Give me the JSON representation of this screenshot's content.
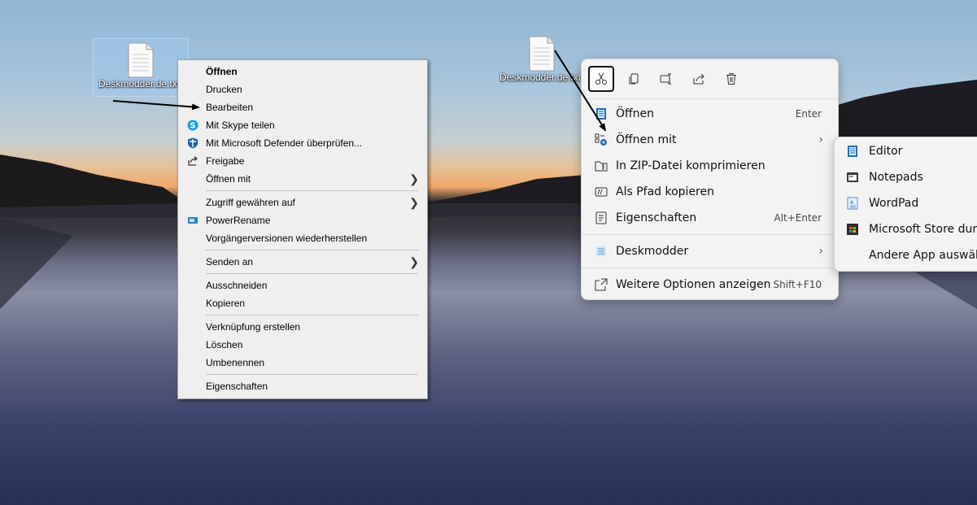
{
  "desktop": {
    "icons": [
      {
        "label": "Deskmodder.de.txt"
      },
      {
        "label": "Deskmodder.de.txt"
      }
    ]
  },
  "classic_menu": {
    "items": [
      {
        "label": "Öffnen",
        "icon": "none"
      },
      {
        "label": "Drucken",
        "icon": "none"
      },
      {
        "label": "Bearbeiten",
        "icon": "none"
      },
      {
        "label": "Mit Skype teilen",
        "icon": "skype-icon"
      },
      {
        "label": "Mit Microsoft Defender überprüfen...",
        "icon": "defender-icon"
      },
      {
        "label": "Freigabe",
        "icon": "share-icon"
      },
      {
        "label": "Öffnen mit",
        "icon": "none"
      },
      {
        "label": "Zugriff gewähren auf",
        "icon": "none"
      },
      {
        "label": "PowerRename",
        "icon": "powerrename-icon"
      },
      {
        "label": "Vorgängerversionen wiederherstellen",
        "icon": "none"
      },
      {
        "label": "Senden an",
        "icon": "none"
      },
      {
        "label": "Ausschneiden",
        "icon": "none"
      },
      {
        "label": "Kopieren",
        "icon": "none"
      },
      {
        "label": "Verknüpfung erstellen",
        "icon": "none"
      },
      {
        "label": "Löschen",
        "icon": "none"
      },
      {
        "label": "Umbenennen",
        "icon": "none"
      },
      {
        "label": "Eigenschaften",
        "icon": "none"
      }
    ]
  },
  "w11_menu": {
    "toolbar": [
      "cut-icon",
      "copy-icon",
      "rename-icon",
      "share-icon",
      "delete-icon"
    ],
    "items": [
      {
        "label": "Öffnen",
        "shortcut": "Enter",
        "icon": "notepad-icon"
      },
      {
        "label": "Öffnen mit",
        "shortcut": "",
        "icon": "open-with-icon"
      },
      {
        "label": "In ZIP-Datei komprimieren",
        "shortcut": "",
        "icon": "zip-icon"
      },
      {
        "label": "Als Pfad kopieren",
        "shortcut": "",
        "icon": "copy-path-icon"
      },
      {
        "label": "Eigenschaften",
        "shortcut": "Alt+Enter",
        "icon": "properties-icon"
      },
      {
        "label": "Deskmodder",
        "shortcut": "",
        "icon": "deskmodder-icon"
      },
      {
        "label": "Weitere Optionen anzeigen",
        "shortcut": "Shift+F10",
        "icon": "more-options-icon"
      }
    ]
  },
  "submenu": {
    "items": [
      {
        "label": "Editor",
        "icon": "editor-icon"
      },
      {
        "label": "Notepads",
        "icon": "notepads-icon"
      },
      {
        "label": "WordPad",
        "icon": "wordpad-icon"
      },
      {
        "label": "Microsoft Store durchsuchen",
        "icon": "store-icon"
      },
      {
        "label": "Andere App auswählen",
        "icon": "none"
      }
    ]
  },
  "colors": {
    "accent": "#0067c0",
    "menu_bg": "#efefef",
    "w11_bg": "#f3f3f3"
  }
}
